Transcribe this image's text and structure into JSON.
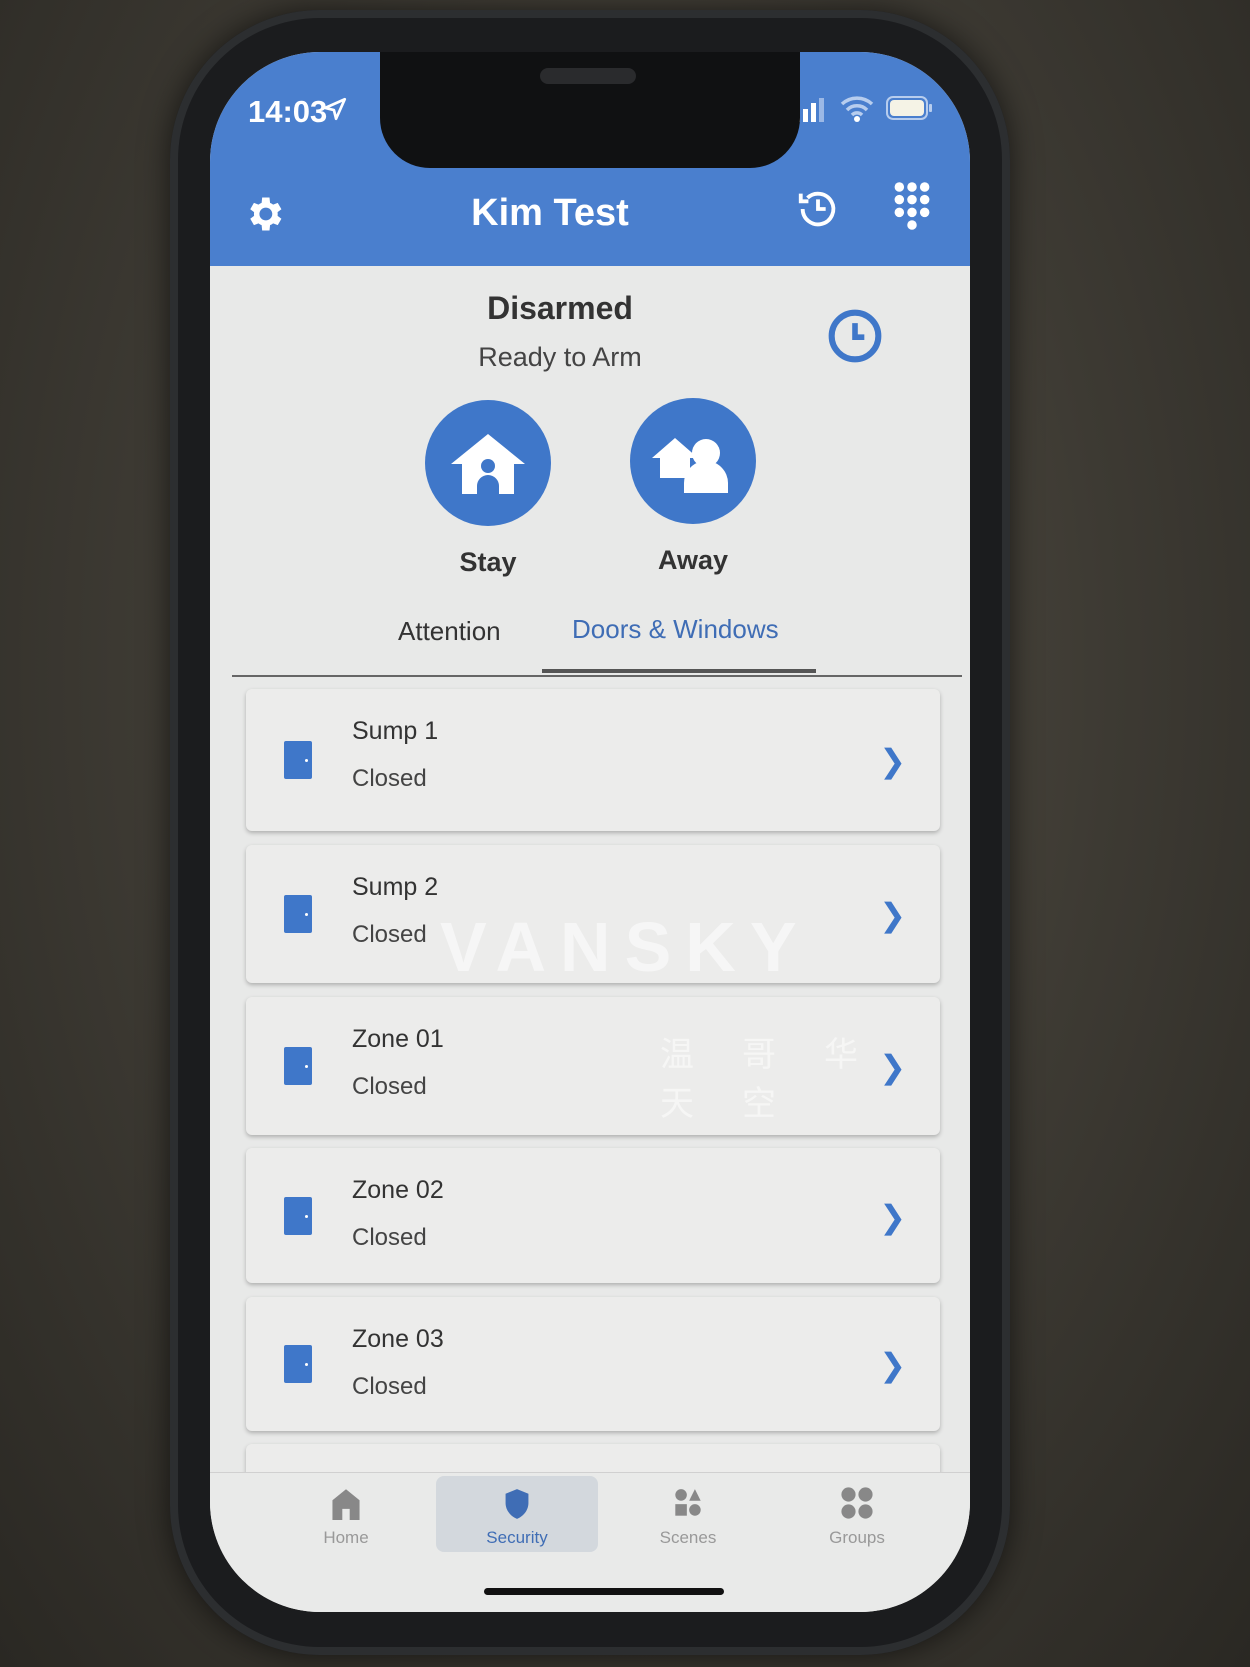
{
  "status_bar": {
    "time": "14:03",
    "icons": [
      "location-arrow-icon",
      "cellular-signal-icon",
      "wifi-icon",
      "battery-icon"
    ]
  },
  "header": {
    "title": "Kim Test",
    "left_icon": "gear-icon",
    "right_icons": [
      "history-icon",
      "keypad-icon"
    ],
    "color": "#4a7fce"
  },
  "arm_status": {
    "state": "Disarmed",
    "substate": "Ready to Arm",
    "timer_icon": "clock-icon"
  },
  "arm_buttons": [
    {
      "label": "Stay",
      "icon": "house-person-icon"
    },
    {
      "label": "Away",
      "icon": "house-person-away-icon"
    }
  ],
  "tabs": [
    {
      "label": "Attention",
      "active": false
    },
    {
      "label": "Doors & Windows",
      "active": true
    }
  ],
  "zones": [
    {
      "name": "Sump 1",
      "status": "Closed"
    },
    {
      "name": "Sump 2",
      "status": "Closed"
    },
    {
      "name": "Zone 01",
      "status": "Closed"
    },
    {
      "name": "Zone 02",
      "status": "Closed"
    },
    {
      "name": "Zone 03",
      "status": "Closed"
    }
  ],
  "bottom_nav": [
    {
      "label": "Home",
      "icon": "home-icon",
      "active": false
    },
    {
      "label": "Security",
      "icon": "shield-icon",
      "active": true
    },
    {
      "label": "Scenes",
      "icon": "shapes-icon",
      "active": false
    },
    {
      "label": "Groups",
      "icon": "groups-icon",
      "active": false
    }
  ],
  "watermark": {
    "text": "VANSKY",
    "subtext": "温哥华天空"
  },
  "accent_color": "#3f77c9"
}
